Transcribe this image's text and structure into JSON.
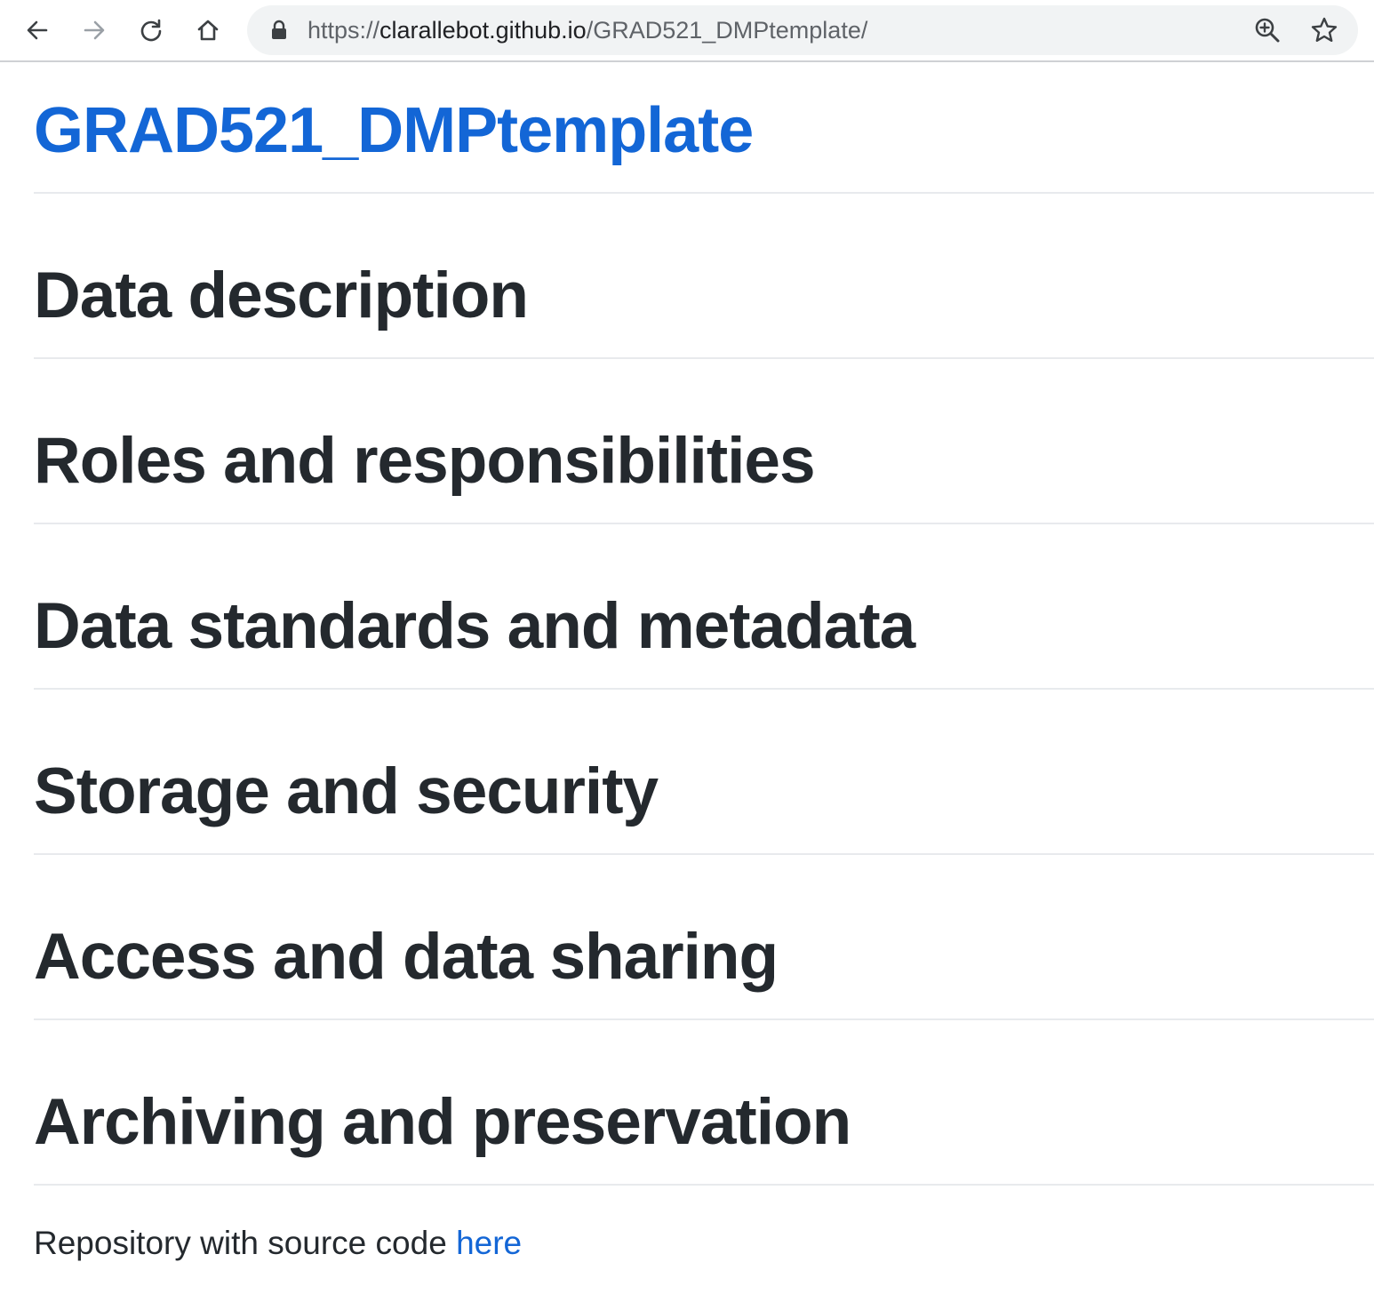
{
  "browser": {
    "url_scheme": "https://",
    "url_host": "clarallebot.github.io",
    "url_path": "/GRAD521_DMPtemplate/",
    "icons": [
      "back-arrow-icon",
      "forward-arrow-icon",
      "reload-icon",
      "home-icon",
      "lock-icon",
      "zoom-icon",
      "bookmark-star-icon"
    ]
  },
  "page": {
    "title": "GRAD521_DMPtemplate",
    "sections": [
      "Data description",
      "Roles and responsibilities",
      "Data standards and metadata",
      "Storage and security",
      "Access and data sharing",
      "Archiving and preservation"
    ],
    "footer_text": "Repository with source code ",
    "footer_link": "here"
  },
  "colors": {
    "link": "#1366d6",
    "heading": "#24292e",
    "divider": "#e8eaed",
    "omnibox": "#f1f3f4"
  }
}
